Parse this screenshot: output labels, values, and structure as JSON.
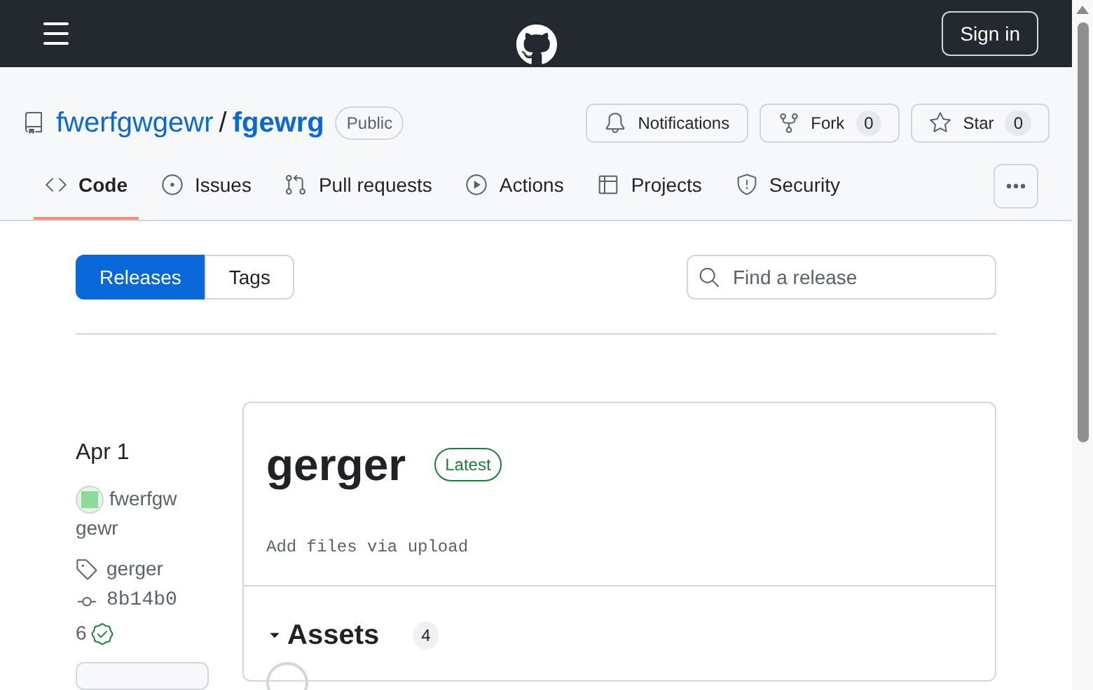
{
  "header": {
    "sign_in": "Sign in"
  },
  "repo": {
    "owner": "fwerfgwgewr",
    "separator": "/",
    "name": "fgewrg",
    "visibility": "Public",
    "actions": [
      {
        "kind": "notifications",
        "label": "Notifications"
      },
      {
        "kind": "fork",
        "label": "Fork",
        "count": "0"
      },
      {
        "kind": "star",
        "label": "Star",
        "count": "0"
      }
    ]
  },
  "tabs": [
    {
      "kind": "code",
      "label": "Code",
      "selected": true
    },
    {
      "kind": "issues",
      "label": "Issues",
      "selected": false
    },
    {
      "kind": "pulls",
      "label": "Pull requests",
      "selected": false
    },
    {
      "kind": "actions",
      "label": "Actions",
      "selected": false
    },
    {
      "kind": "projects",
      "label": "Projects",
      "selected": false
    },
    {
      "kind": "security",
      "label": "Security",
      "selected": false
    }
  ],
  "subnav": [
    {
      "label": "Releases",
      "selected": true
    },
    {
      "label": "Tags",
      "selected": false
    }
  ],
  "search": {
    "placeholder": "Find a release"
  },
  "release": {
    "date": "Apr 1",
    "author": "fwerfgw gewr",
    "tag": "gerger",
    "commit": "8b14b0",
    "checks": "6",
    "title": "gerger",
    "badge": "Latest",
    "description": "Add files via upload",
    "assets_label": "Assets",
    "assets_count": "4"
  }
}
